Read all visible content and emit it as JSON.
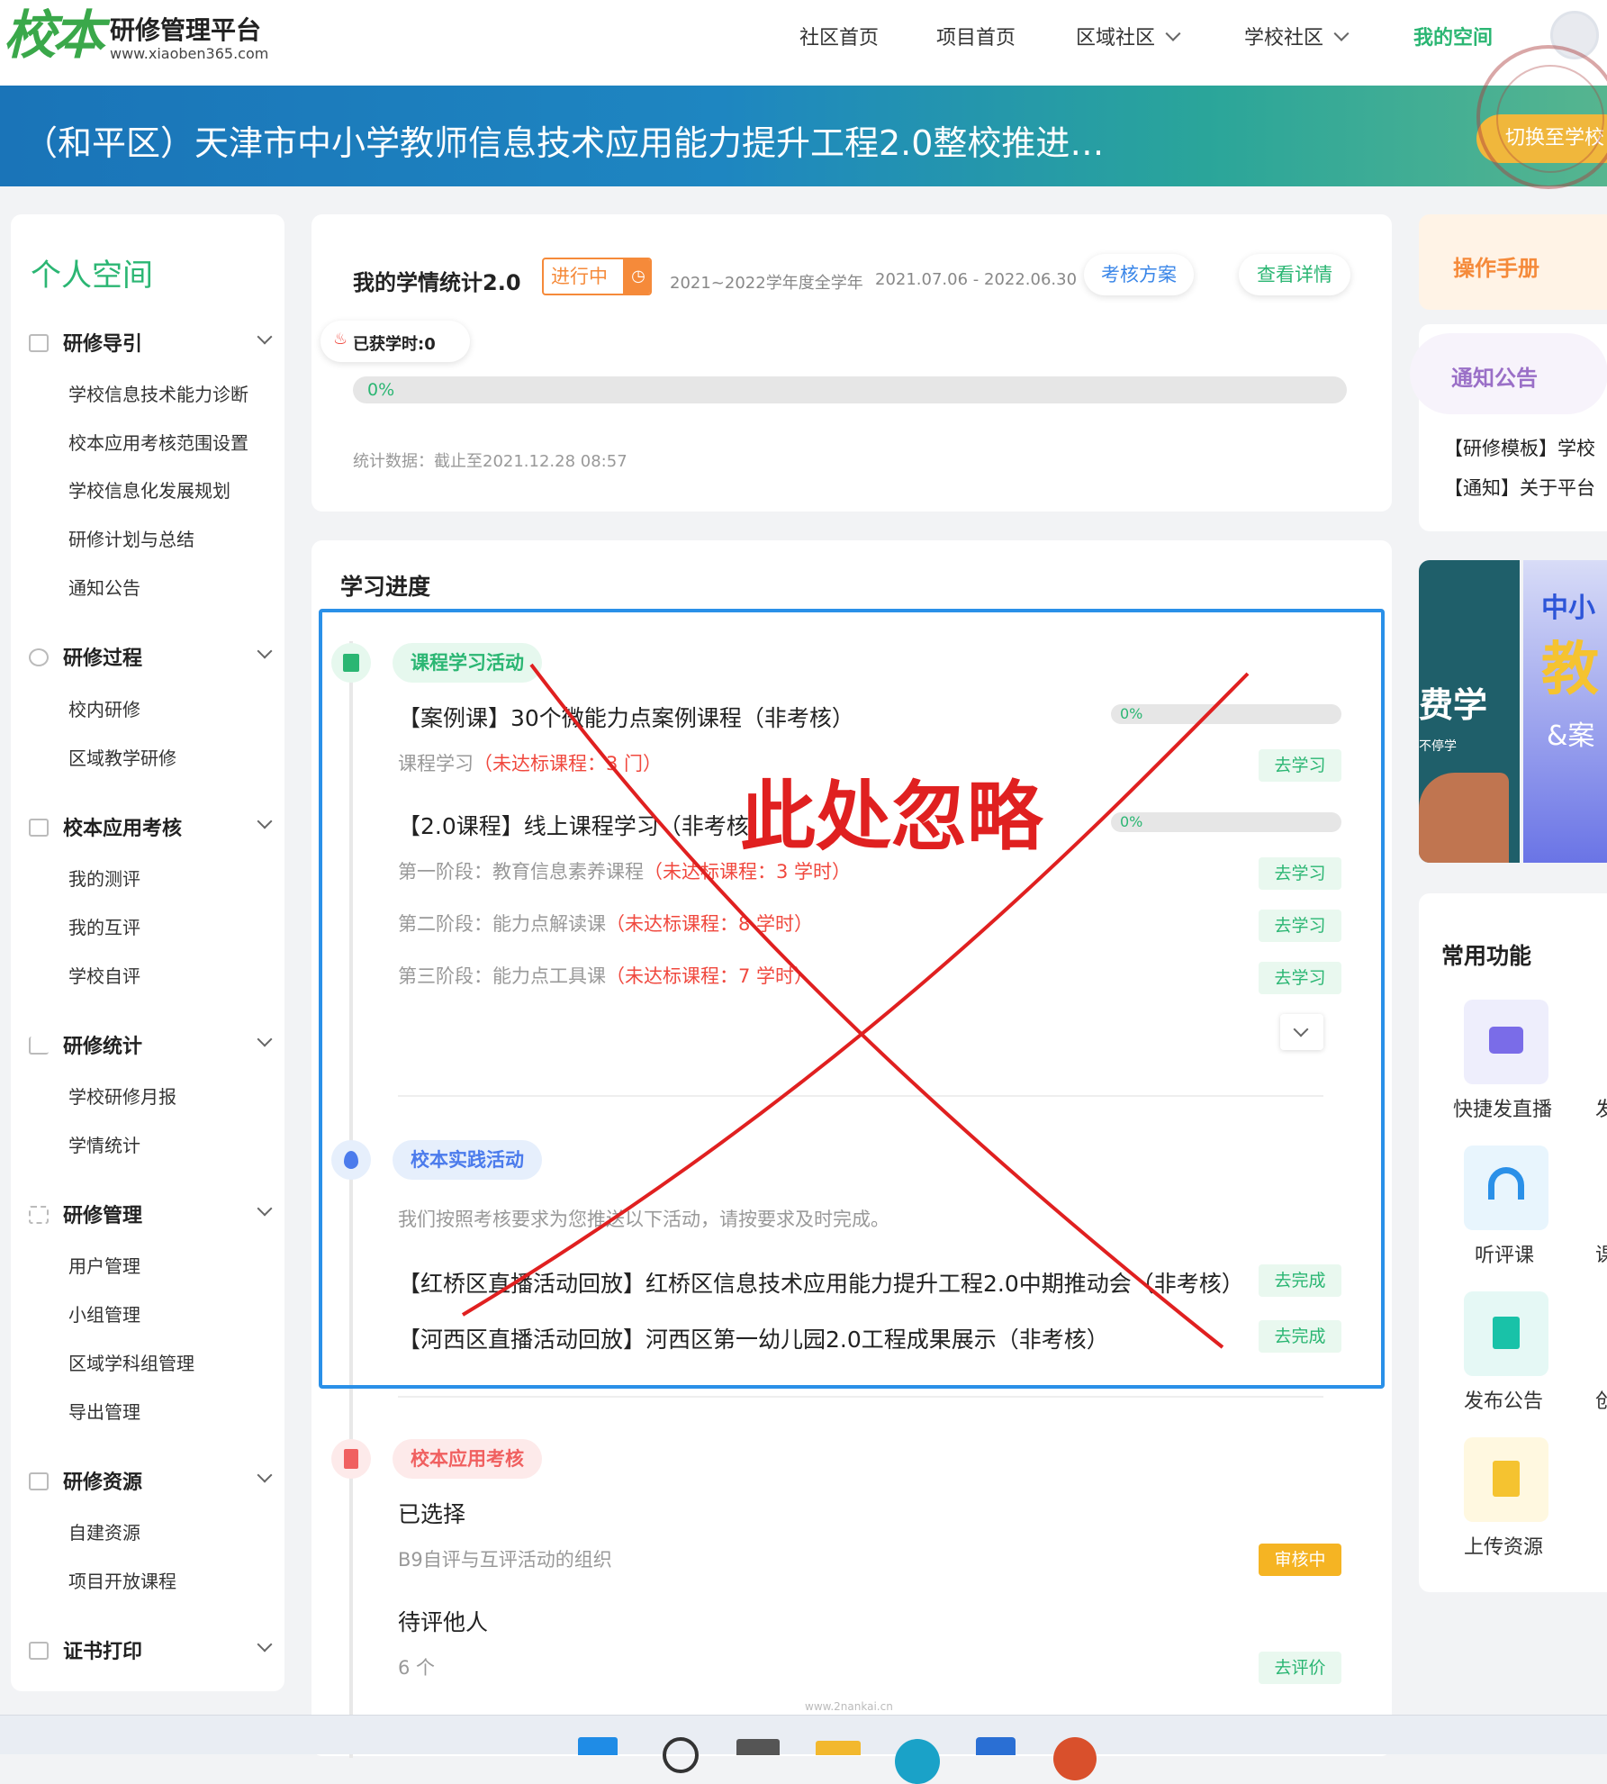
{
  "brand": {
    "logo": "校本",
    "title": "研修管理平台",
    "url": "www.xiaoben365.com"
  },
  "nav": {
    "community_home": "社区首页",
    "project_home": "项目首页",
    "region_community": "区域社区",
    "school_community": "学校社区",
    "my_space": "我的空间"
  },
  "banner": {
    "title": "（和平区）天津市中小学教师信息技术应用能力提升工程2.0整校推进…",
    "switch": "切换至学校"
  },
  "sidebar": {
    "title": "个人空间",
    "groups": [
      {
        "label": "研修导引",
        "items": [
          "学校信息技术能力诊断",
          "校本应用考核范围设置",
          "学校信息化发展规划",
          "研修计划与总结",
          "通知公告"
        ]
      },
      {
        "label": "研修过程",
        "items": [
          "校内研修",
          "区域教学研修"
        ]
      },
      {
        "label": "校本应用考核",
        "items": [
          "我的测评",
          "我的互评",
          "学校自评"
        ]
      },
      {
        "label": "研修统计",
        "items": [
          "学校研修月报",
          "学情统计"
        ]
      },
      {
        "label": "研修管理",
        "items": [
          "用户管理",
          "小组管理",
          "区域学科组管理",
          "导出管理"
        ]
      },
      {
        "label": "研修资源",
        "items": [
          "自建资源",
          "项目开放课程"
        ]
      },
      {
        "label": "证书打印",
        "items": []
      }
    ]
  },
  "stats": {
    "title": "我的学情统计2.0",
    "status": "进行中",
    "year": "2021~2022学年度全学年",
    "range": "2021.07.06 - 2022.06.30",
    "plan_btn": "考核方案",
    "detail_btn": "查看详情",
    "hours_label": "已获学时:0",
    "progress": 0,
    "progress_text": "0%",
    "note": "统计数据：截止至2021.12.28 08:57"
  },
  "progress": {
    "title": "学习进度",
    "course": {
      "tag": "课程学习活动",
      "c1_title": "【案例课】30个微能力点案例课程（非考核）",
      "c1_pct": "0%",
      "c1_sub": "课程学习",
      "c1_warn": "（未达标课程：3 门）",
      "c2_title": "【2.0课程】线上课程学习（非考核）",
      "c2_pct": "0%",
      "s1": "第一阶段：教育信息素养课程",
      "s1_warn": "（未达标课程：3 学时）",
      "s2": "第二阶段：能力点解读课",
      "s2_warn": "（未达标课程：8 学时）",
      "s3": "第三阶段：能力点工具课",
      "s3_warn": "（未达标课程：7 学时）",
      "go": "去学习"
    },
    "practice": {
      "tag": "校本实践活动",
      "desc": "我们按照考核要求为您推送以下活动，请按要求及时完成。",
      "a1": "【红桥区直播活动回放】红桥区信息技术应用能力提升工程2.0中期推动会（非考核）",
      "a2": "【河西区直播活动回放】河西区第一幼儿园2.0工程成果展示（非考核）",
      "go": "去完成"
    },
    "assess": {
      "tag": "校本应用考核",
      "selected": "已选择",
      "selected_item": "B9自评与互评活动的组织",
      "status": "审核中",
      "pending": "待评他人",
      "pending_count": "6 个",
      "go": "去评价"
    },
    "overlay_text": "此处忽略"
  },
  "right": {
    "manual": "操作手册",
    "notice_title": "通知公告",
    "notice_items": [
      "【研修模板】学校",
      "【通知】关于平台"
    ],
    "promo": {
      "left_text": "费学",
      "left_small": "不停学",
      "right_top": "中小",
      "right_big": "教",
      "right_mid": "&案"
    },
    "funcs_title": "常用功能",
    "funcs": [
      "快捷发直播",
      "听评课",
      "发布公告",
      "上传资源"
    ],
    "funcs_right_partial": [
      "发",
      "课",
      "创"
    ]
  },
  "watermark": "www.2nankai.cn",
  "colors": {
    "accent": "#2bb673",
    "warn": "#f0483e",
    "highlight_box": "#2a90e8",
    "cross": "#e02020",
    "practice": "#4b7bec",
    "assess": "#f06060"
  }
}
